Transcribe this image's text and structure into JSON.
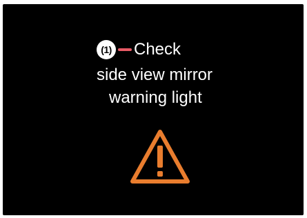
{
  "callout": {
    "number": "(1)",
    "leader_color": "#e85a66"
  },
  "message": {
    "line1": "Check",
    "line2": "side view mirror",
    "line3": "warning light"
  },
  "icon": {
    "name": "warning-triangle-icon",
    "color": "#e97d2e"
  }
}
